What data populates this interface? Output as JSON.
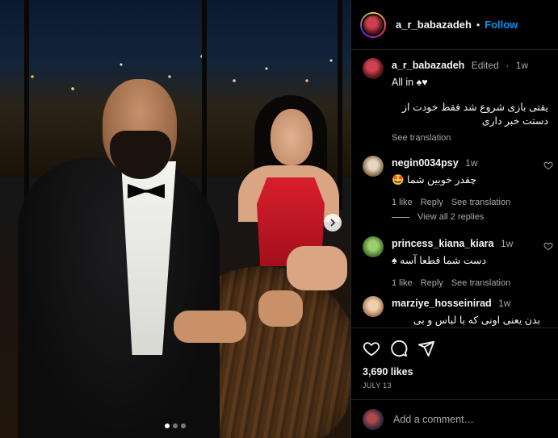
{
  "post": {
    "username": "a_r_babazadeh",
    "follow_label": "Follow",
    "separator": "•"
  },
  "caption": {
    "username": "a_r_babazadeh",
    "edited": "Edited",
    "dot": "·",
    "time": "1w",
    "line1": "All in ♠♥",
    "line2": "یقتی بازی شروع شد فقط خودت از دستت خبر داری",
    "see_translation": "See translation"
  },
  "comments": [
    {
      "username": "negin0034psy",
      "time": "1w",
      "text": "چقدر خوبین شما 🤩",
      "likes": "1 like",
      "reply": "Reply",
      "see_translation": "See translation"
    },
    {
      "username": "princess_kiana_kiara",
      "time": "1w",
      "text": "دست شما قطعا آسه ♠",
      "likes": "1 like",
      "reply": "Reply",
      "see_translation": "See translation"
    },
    {
      "username": "marziye_hosseinirad",
      "time": "1w",
      "text": "بدن یعنی اونی که با لباس و بی لباس"
    }
  ],
  "view_replies": "View all 2 replies",
  "likes": "3,690 likes",
  "date": "JULY 13",
  "add_comment_placeholder": "Add a comment…",
  "carousel": {
    "current": 1,
    "total": 3
  },
  "colors": {
    "accent": "#0095f6",
    "muted": "#a8a8a8",
    "background": "#000000"
  },
  "icons": [
    "heart-icon",
    "comment-icon",
    "share-icon",
    "chevron-right-icon"
  ]
}
